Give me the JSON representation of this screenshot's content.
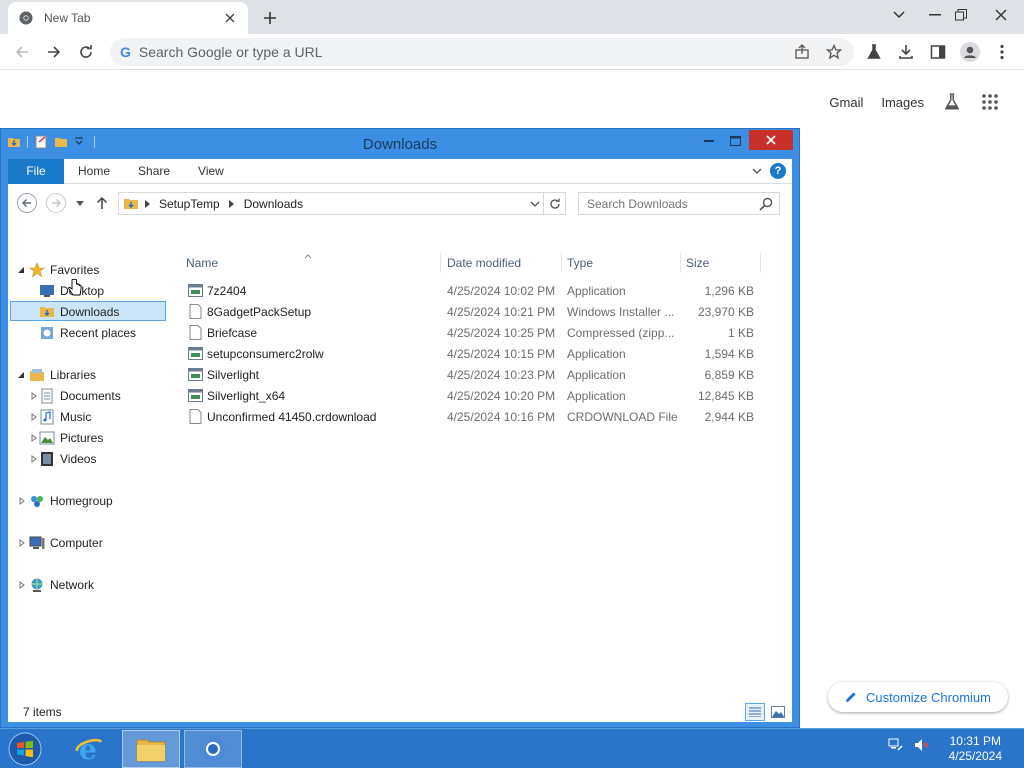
{
  "browser": {
    "tab_title": "New Tab",
    "omnibox_placeholder": "Search Google or type a URL",
    "ntp_links": {
      "gmail": "Gmail",
      "images": "Images"
    },
    "customize_label": "Customize Chromium"
  },
  "explorer": {
    "title": "Downloads",
    "ribbon_tabs": {
      "file": "File",
      "home": "Home",
      "share": "Share",
      "view": "View"
    },
    "breadcrumb": [
      "SetupTemp",
      "Downloads"
    ],
    "search_placeholder": "Search Downloads",
    "nav": {
      "favorites": "Favorites",
      "desktop": "Desktop",
      "downloads": "Downloads",
      "recent": "Recent places",
      "libraries": "Libraries",
      "documents": "Documents",
      "music": "Music",
      "pictures": "Pictures",
      "videos": "Videos",
      "homegroup": "Homegroup",
      "computer": "Computer",
      "network": "Network"
    },
    "columns": {
      "name": "Name",
      "date": "Date modified",
      "type": "Type",
      "size": "Size"
    },
    "files": [
      {
        "name": "7z2404",
        "date": "4/25/2024 10:02 PM",
        "type": "Application",
        "size": "1,296 KB",
        "icon": "application-icon"
      },
      {
        "name": "8GadgetPackSetup",
        "date": "4/25/2024 10:21 PM",
        "type": "Windows Installer ...",
        "size": "23,970 KB",
        "icon": "installer-icon"
      },
      {
        "name": "Briefcase",
        "date": "4/25/2024 10:25 PM",
        "type": "Compressed (zipp...",
        "size": "1 KB",
        "icon": "file-icon"
      },
      {
        "name": "setupconsumerc2rolw",
        "date": "4/25/2024 10:15 PM",
        "type": "Application",
        "size": "1,594 KB",
        "icon": "application-icon"
      },
      {
        "name": "Silverlight",
        "date": "4/25/2024 10:23 PM",
        "type": "Application",
        "size": "6,859 KB",
        "icon": "application-icon"
      },
      {
        "name": "Silverlight_x64",
        "date": "4/25/2024 10:20 PM",
        "type": "Application",
        "size": "12,845 KB",
        "icon": "application-icon"
      },
      {
        "name": "Unconfirmed 41450.crdownload",
        "date": "4/25/2024 10:16 PM",
        "type": "CRDOWNLOAD File",
        "size": "2,944 KB",
        "icon": "file-icon"
      }
    ],
    "status": "7 items"
  },
  "taskbar": {
    "time": "10:31 PM",
    "date": "4/25/2024"
  },
  "colors": {
    "explorer_frame": "#3c8fe3",
    "taskbar": "#2a74cc",
    "close_red": "#c7302b",
    "file_tab": "#1979ca",
    "chrome_link_blue": "#1a73e8"
  }
}
